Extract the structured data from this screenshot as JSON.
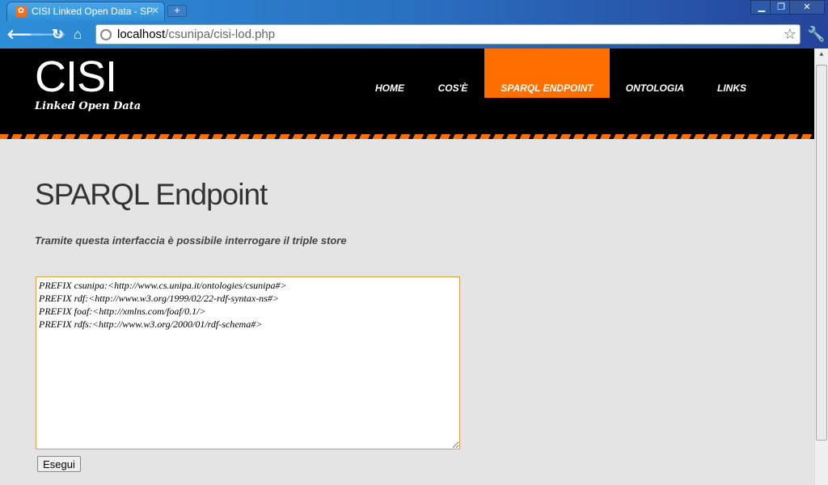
{
  "browser": {
    "tab_title": "CISI Linked Open Data - SPARQL Endpoint",
    "url_host": "localhost",
    "url_path": "/csunipa/cisi-lod.php"
  },
  "site": {
    "logo": "CISI",
    "subtitle": "Linked Open Data",
    "accent": "#ff6f00",
    "menu": [
      {
        "label": "HOME"
      },
      {
        "label": "COS'È"
      },
      {
        "label": "SPARQL ENDPOINT",
        "active": true
      },
      {
        "label": "ONTOLOGIA"
      },
      {
        "label": "LINKS"
      }
    ]
  },
  "main": {
    "title": "SPARQL Endpoint",
    "intro": "Tramite questa interfaccia è possibile interrogare il triple store",
    "query": "PREFIX csunipa:<http://www.cs.unipa.it/ontologies/csunipa#>\nPREFIX rdf:<http://www.w3.org/1999/02/22-rdf-syntax-ns#>\nPREFIX foaf:<http://xmlns.com/foaf/0.1/>\nPREFIX rdfs:<http://www.w3.org/2000/01/rdf-schema#>",
    "run_label": "Esegui"
  }
}
